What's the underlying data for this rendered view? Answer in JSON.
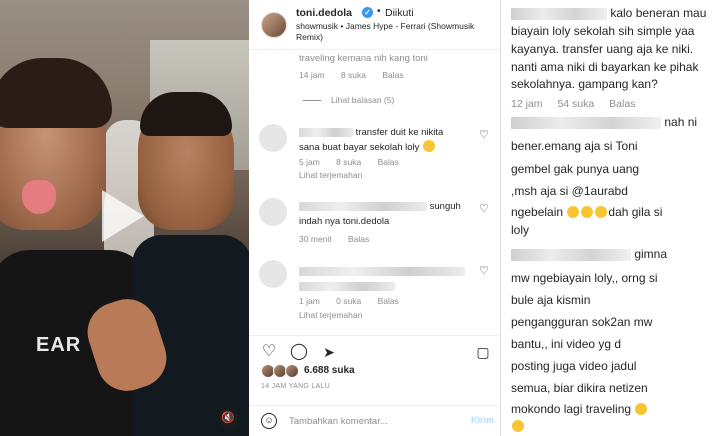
{
  "post": {
    "username": "toni.dedola",
    "follow_status": "Diikuti",
    "music": "showmusik • James Hype - Ferrari (Showmusik Remix)",
    "likes": "6.688 suka",
    "time_ago": "14 JAM YANG LALU"
  },
  "comments": [
    {
      "text": "traveling kemana nih kang toni",
      "time": "14 jam",
      "likes": "8 suka",
      "reply": "Balas",
      "view_replies": "Lihat balasan (5)"
    },
    {
      "text_line1": "transfer duit ke nikita",
      "text_line2": "sana buat bayar sekolah loly",
      "time": "5 jam",
      "likes": "8 suka",
      "reply": "Balas",
      "translate": "Lihat terjemahan"
    },
    {
      "text_line1": "sunguh",
      "text_line2": "indah nya toni.dedola",
      "time": "30 menit",
      "reply": "Balas"
    },
    {
      "time": "1 jam",
      "likes": "0 suka",
      "reply": "Balas",
      "translate": "Lihat terjemahan"
    }
  ],
  "comment_input": {
    "placeholder": "Tambahkan komentar...",
    "send_label": "Kirim"
  },
  "video": {
    "shirt_text": "EAR"
  },
  "zoomed": {
    "c1_lines": [
      "kalo beneran mau",
      "biayain loly sekolah sih simple yaa",
      "kayanya. transfer uang aja ke niki.",
      "nanti ama niki di bayarkan ke pihak",
      "sekolahnya. gampang kan?"
    ],
    "c1_time": "12 jam",
    "c1_likes": "54 suka",
    "c1_reply": "Balas",
    "c2_lines": [
      "nah ni",
      "bener.emang aja si Toni",
      "gembel gak punya uang",
      ",msh aja si @1aurabd",
      "ngebelain",
      "dah gila si",
      "loly"
    ],
    "c3_lines": [
      "gimna",
      "mw ngebiayain loly,, orng si",
      "bule aja kismin",
      "pengangguran sok2an mw",
      "bantu,, ini video yg d",
      "posting juga video jadul",
      "semua, biar dikira netizen",
      "mokondo lagi traveling"
    ]
  },
  "colors": {
    "verified_blue": "#3897f0",
    "meta_gray": "#8e8e8e",
    "send_disabled": "#b2dffc",
    "emoji_yellow": "#f7c531"
  },
  "icons": [
    "heart-icon",
    "comment-icon",
    "share-icon",
    "bookmark-icon",
    "emoji-icon",
    "mute-icon",
    "play-icon",
    "verified-icon"
  ]
}
